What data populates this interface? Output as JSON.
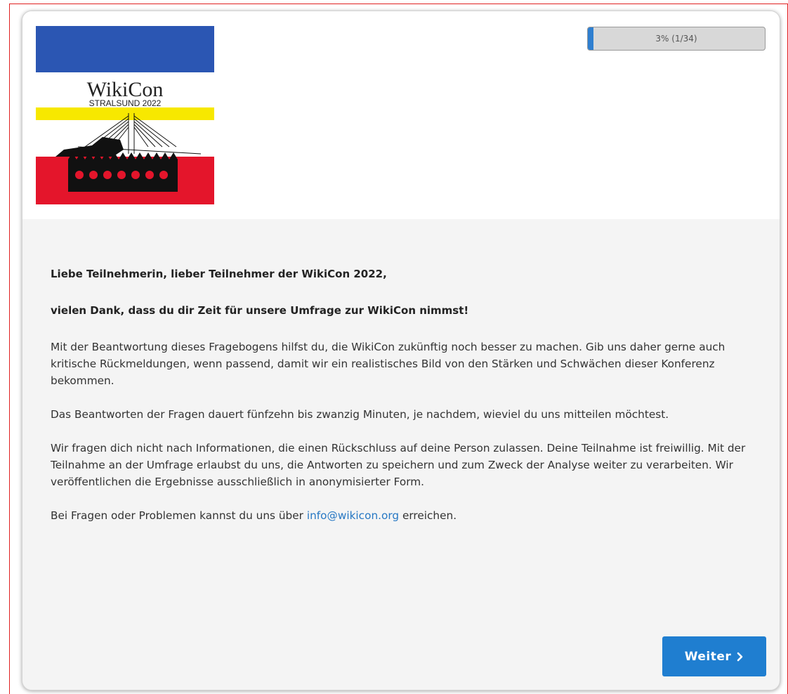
{
  "survey": {
    "logo": {
      "title": "WikiCon",
      "subtitle": "STRALSUND 2022",
      "colors": [
        "#2b56b3",
        "#ffffff",
        "#f7e800",
        "#e4152b"
      ]
    },
    "progress": {
      "text": "3% (1/34)",
      "percent": 3,
      "current": 1,
      "total": 34,
      "color": "#2f7fd0"
    },
    "intro": {
      "greeting": "Liebe Teilnehmerin, lieber Teilnehmer der WikiCon 2022,",
      "thanks": "vielen Dank, dass du dir Zeit für unsere Umfrage zur WikiCon nimmst!",
      "paragraph1": "Mit der Beantwortung dieses Fragebogens hilfst du, die WikiCon zukünftig noch besser zu machen. Gib uns daher gerne auch kritische Rückmeldungen, wenn passend, damit wir ein realistisches Bild von den Stärken und Schwächen dieser Konferenz bekommen.",
      "paragraph2": "Das Beantworten der Fragen dauert fünfzehn bis zwanzig Minuten, je nachdem, wieviel du uns mitteilen möchtest.",
      "paragraph3": "Wir fragen dich nicht nach Informationen, die einen Rückschluss auf deine Person zulassen. Deine Teilnahme ist freiwillig. Mit der Teilnahme an der Umfrage erlaubst du uns, die Antworten zu speichern und zum Zweck der Analyse weiter zu verarbeiten. Wir veröffentlichen die Ergebnisse ausschließlich in anonymisierter Form.",
      "contact_before": "Bei Fragen oder Problemen kannst du uns über ",
      "contact_email": "info@wikicon.org",
      "contact_after": " erreichen."
    },
    "next_button": {
      "label": "Weiter",
      "icon": "chevron-right-icon",
      "color": "#1f7ed0"
    }
  }
}
